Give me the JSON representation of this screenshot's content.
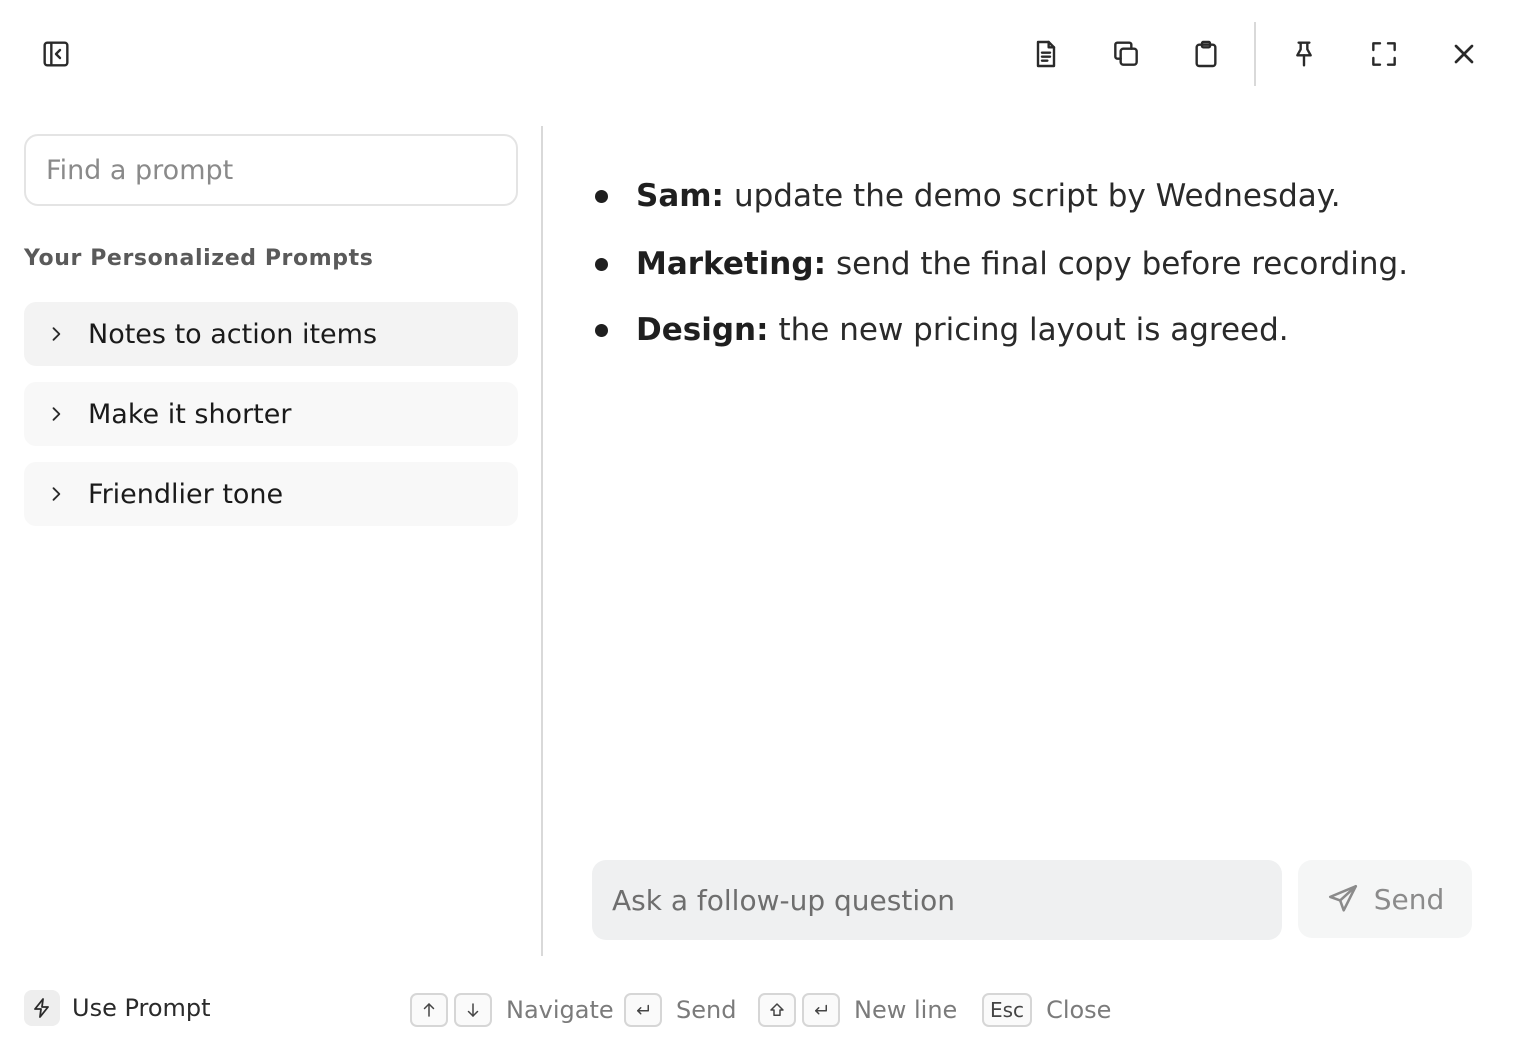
{
  "toolbar": {
    "left_icon": "sidebar-collapse-icon",
    "right_icons": [
      "document-icon",
      "copy-icon",
      "clipboard-icon",
      "pin-icon",
      "fullscreen-icon",
      "close-icon"
    ]
  },
  "sidebar": {
    "search_placeholder": "Find a prompt",
    "section_title": "Your Personalized Prompts",
    "items": [
      {
        "label": "Notes to action items"
      },
      {
        "label": "Make it shorter"
      },
      {
        "label": "Friendlier tone"
      }
    ]
  },
  "content": {
    "bullets": [
      {
        "label": "Sam:",
        "text": "update the demo script by Wednesday."
      },
      {
        "label": "Marketing:",
        "text": "send the final copy before recording."
      },
      {
        "label": "Design:",
        "text": "the new pricing layout is agreed."
      }
    ],
    "followup_placeholder": "Ask a follow-up question",
    "send_label": "Send"
  },
  "footer": {
    "use_prompt_label": "Use Prompt",
    "shortcuts": [
      {
        "keys": [
          "↑",
          "↓"
        ],
        "label": "Navigate"
      },
      {
        "keys": [
          "↵"
        ],
        "label": "Send"
      },
      {
        "keys": [
          "⇧",
          "↵"
        ],
        "label": "New line"
      },
      {
        "keys": [
          "Esc"
        ],
        "label": "Close"
      }
    ]
  },
  "colors": {
    "item_bg_selected": "#f3f3f3",
    "item_bg": "#f8f8f8",
    "input_bg": "#eff0f1",
    "divider": "#d9d9d9"
  }
}
